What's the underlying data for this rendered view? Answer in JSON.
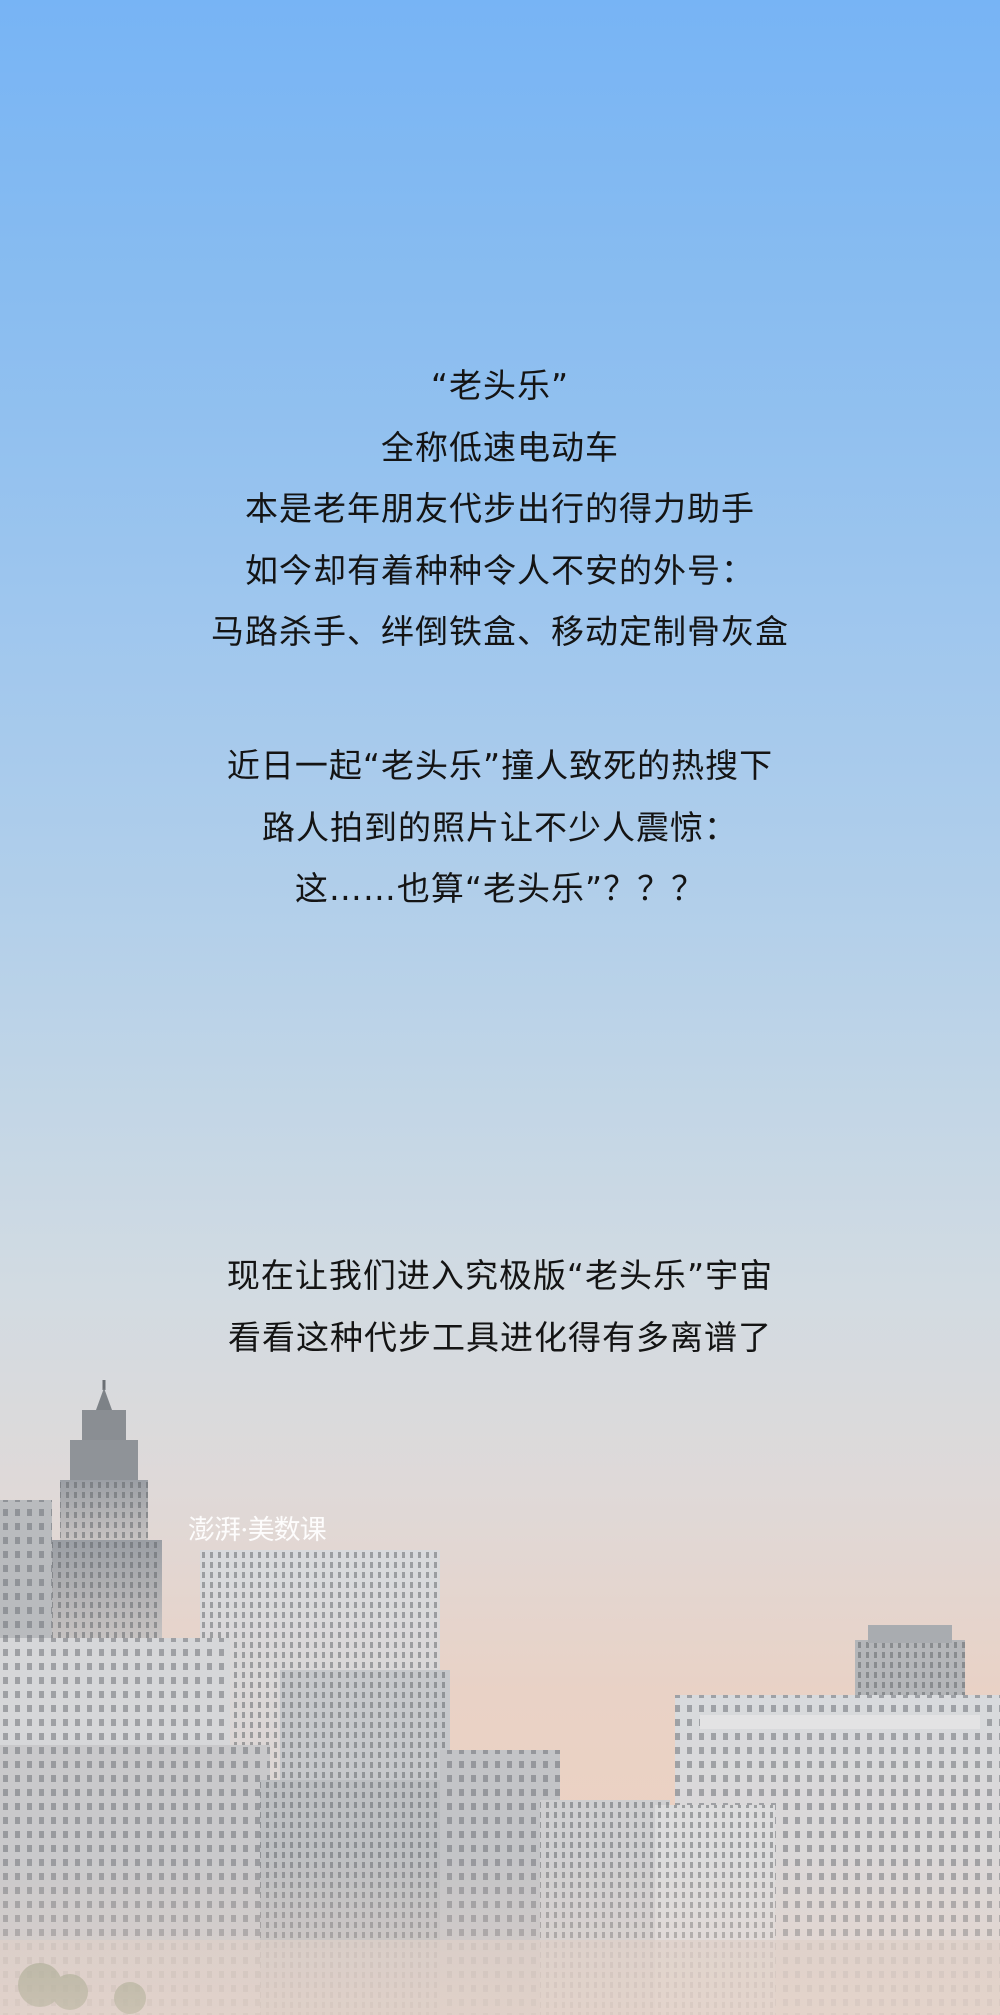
{
  "intro": {
    "lines": [
      "“老头乐”",
      "全称低速电动车",
      "本是老年朋友代步出行的得力助手",
      "如今却有着种种令人不安的外号：",
      "马路杀手、绊倒铁盒、移动定制骨灰盒"
    ]
  },
  "news": {
    "lines": [
      "近日一起“老头乐”撞人致死的热搜下",
      "路人拍到的照片让不少人震惊：",
      "这……也算“老头乐”？？？"
    ]
  },
  "outro": {
    "lines": [
      "现在让我们进入究极版“老头乐”宇宙",
      "看看这种代步工具进化得有多离谱了"
    ]
  },
  "watermark": "澎湃·美数课",
  "colors": {
    "sky_top": "#77b4f5",
    "sky_horizon": "#ecd1c2",
    "text": "#141414",
    "buildings": "#c9c9c9"
  }
}
